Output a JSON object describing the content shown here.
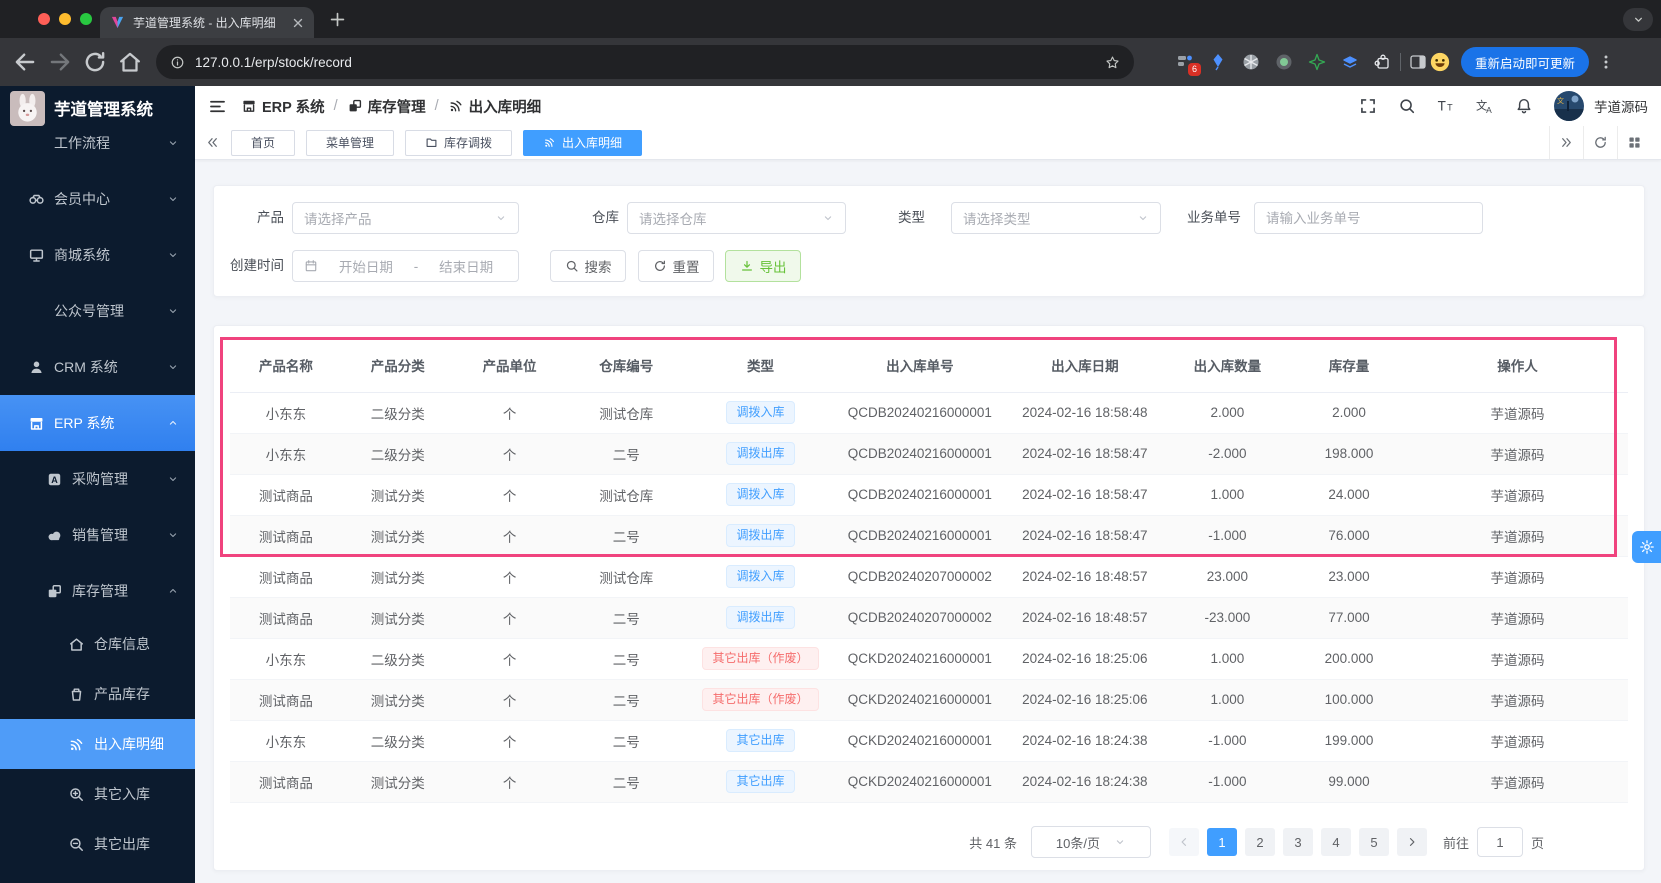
{
  "colors": {
    "accent": "#409eff",
    "annotation_pink": "#f0437e",
    "success_green": "#67c23a",
    "danger_red": "#f56c6c",
    "chrome_update_blue": "#1a73e8"
  },
  "browser": {
    "tab_title": "芋道管理系统 - 出入库明细",
    "url": "127.0.0.1/erp/stock/record",
    "update_button_label": "重新启动即可更新",
    "extension_badge_count": "6"
  },
  "sidebar": {
    "logo_title": "芋道管理系统",
    "items": [
      {
        "name": "workflow",
        "label": "工作流程",
        "level": 1,
        "icon": null,
        "chevron": "down"
      },
      {
        "name": "member-center",
        "label": "会员中心",
        "level": 1,
        "icon": "member-icon",
        "chevron": "down"
      },
      {
        "name": "mall-system",
        "label": "商城系统",
        "level": 1,
        "icon": "mall-icon",
        "chevron": "down"
      },
      {
        "name": "official-account",
        "label": "公众号管理",
        "level": 1,
        "icon": null,
        "chevron": "down"
      },
      {
        "name": "crm-system",
        "label": "CRM 系统",
        "level": 1,
        "icon": "crm-user-icon",
        "chevron": "down"
      },
      {
        "name": "erp-system",
        "label": "ERP 系统",
        "level": 1,
        "icon": "erp-store-icon",
        "chevron": "up",
        "active": true
      },
      {
        "name": "purchase-mgmt",
        "label": "采购管理",
        "level": 2,
        "icon": "purchase-icon",
        "chevron": "down"
      },
      {
        "name": "sales-mgmt",
        "label": "销售管理",
        "level": 2,
        "icon": "sales-icon",
        "chevron": "down"
      },
      {
        "name": "stock-mgmt",
        "label": "库存管理",
        "level": 2,
        "icon": "stock-icon",
        "chevron": "up"
      },
      {
        "name": "warehouse-info",
        "label": "仓库信息",
        "level": 3,
        "icon": "warehouse-icon"
      },
      {
        "name": "product-stock",
        "label": "产品库存",
        "level": 3,
        "icon": "product-stock-icon"
      },
      {
        "name": "stock-record",
        "label": "出入库明细",
        "level": 3,
        "icon": "stock-record-icon",
        "active": true
      },
      {
        "name": "other-stock-in",
        "label": "其它入库",
        "level": 3,
        "icon": "stock-in-icon"
      },
      {
        "name": "other-stock-out",
        "label": "其它出库",
        "level": 3,
        "icon": "stock-out-icon"
      }
    ]
  },
  "header": {
    "breadcrumb": [
      {
        "name": "erp-system",
        "label": "ERP 系统",
        "icon": "erp-store-icon"
      },
      {
        "name": "stock-mgmt",
        "label": "库存管理",
        "icon": "stock-icon"
      },
      {
        "name": "stock-record",
        "label": "出入库明细",
        "icon": "stock-record-icon"
      }
    ],
    "username": "芋道源码"
  },
  "tags": [
    {
      "name": "home",
      "label": "首页"
    },
    {
      "name": "menu-mgmt",
      "label": "菜单管理"
    },
    {
      "name": "stock-move",
      "label": "库存调拨",
      "icon": "folder-icon"
    },
    {
      "name": "stock-record",
      "label": "出入库明细",
      "icon": "stock-record-icon",
      "active": true
    }
  ],
  "filters": {
    "product_label": "产品",
    "product_placeholder": "请选择产品",
    "warehouse_label": "仓库",
    "warehouse_placeholder": "请选择仓库",
    "type_label": "类型",
    "type_placeholder": "请选择类型",
    "bizno_label": "业务单号",
    "bizno_placeholder": "请输入业务单号",
    "time_label": "创建时间",
    "time_start_placeholder": "开始日期",
    "time_separator": "-",
    "time_end_placeholder": "结束日期",
    "search_label": "搜索",
    "reset_label": "重置",
    "export_label": "导出"
  },
  "table": {
    "headers": [
      "产品名称",
      "产品分类",
      "产品单位",
      "仓库编号",
      "类型",
      "出入库单号",
      "出入库日期",
      "出入库数量",
      "库存量",
      "操作人"
    ],
    "rows": [
      {
        "product": "小东东",
        "category": "二级分类",
        "unit": "个",
        "warehouse": "测试仓库",
        "type": "调拨入库",
        "type_style": "blue",
        "order_no": "QCDB20240216000001",
        "date": "2024-02-16 18:58:48",
        "qty": "2.000",
        "stock": "2.000",
        "operator": "芋道源码"
      },
      {
        "product": "小东东",
        "category": "二级分类",
        "unit": "个",
        "warehouse": "二号",
        "type": "调拨出库",
        "type_style": "blue",
        "order_no": "QCDB20240216000001",
        "date": "2024-02-16 18:58:47",
        "qty": "-2.000",
        "stock": "198.000",
        "operator": "芋道源码"
      },
      {
        "product": "测试商品",
        "category": "测试分类",
        "unit": "个",
        "warehouse": "测试仓库",
        "type": "调拨入库",
        "type_style": "blue",
        "order_no": "QCDB20240216000001",
        "date": "2024-02-16 18:58:47",
        "qty": "1.000",
        "stock": "24.000",
        "operator": "芋道源码"
      },
      {
        "product": "测试商品",
        "category": "测试分类",
        "unit": "个",
        "warehouse": "二号",
        "type": "调拨出库",
        "type_style": "blue",
        "order_no": "QCDB20240216000001",
        "date": "2024-02-16 18:58:47",
        "qty": "-1.000",
        "stock": "76.000",
        "operator": "芋道源码"
      },
      {
        "product": "测试商品",
        "category": "测试分类",
        "unit": "个",
        "warehouse": "测试仓库",
        "type": "调拨入库",
        "type_style": "blue",
        "order_no": "QCDB20240207000002",
        "date": "2024-02-16 18:48:57",
        "qty": "23.000",
        "stock": "23.000",
        "operator": "芋道源码"
      },
      {
        "product": "测试商品",
        "category": "测试分类",
        "unit": "个",
        "warehouse": "二号",
        "type": "调拨出库",
        "type_style": "blue",
        "order_no": "QCDB20240207000002",
        "date": "2024-02-16 18:48:57",
        "qty": "-23.000",
        "stock": "77.000",
        "operator": "芋道源码"
      },
      {
        "product": "小东东",
        "category": "二级分类",
        "unit": "个",
        "warehouse": "二号",
        "type": "其它出库（作废）",
        "type_style": "red",
        "order_no": "QCKD20240216000001",
        "date": "2024-02-16 18:25:06",
        "qty": "1.000",
        "stock": "200.000",
        "operator": "芋道源码"
      },
      {
        "product": "测试商品",
        "category": "测试分类",
        "unit": "个",
        "warehouse": "二号",
        "type": "其它出库（作废）",
        "type_style": "red",
        "order_no": "QCKD20240216000001",
        "date": "2024-02-16 18:25:06",
        "qty": "1.000",
        "stock": "100.000",
        "operator": "芋道源码"
      },
      {
        "product": "小东东",
        "category": "二级分类",
        "unit": "个",
        "warehouse": "二号",
        "type": "其它出库",
        "type_style": "blue",
        "order_no": "QCKD20240216000001",
        "date": "2024-02-16 18:24:38",
        "qty": "-1.000",
        "stock": "199.000",
        "operator": "芋道源码"
      },
      {
        "product": "测试商品",
        "category": "测试分类",
        "unit": "个",
        "warehouse": "二号",
        "type": "其它出库",
        "type_style": "blue",
        "order_no": "QCKD20240216000001",
        "date": "2024-02-16 18:24:38",
        "qty": "-1.000",
        "stock": "99.000",
        "operator": "芋道源码"
      }
    ]
  },
  "pagination": {
    "total_label": "共 41 条",
    "page_size_label": "10条/页",
    "pages": [
      "1",
      "2",
      "3",
      "4",
      "5"
    ],
    "active_page": "1",
    "goto_label": "前往",
    "goto_value": "1",
    "goto_suffix": "页"
  }
}
